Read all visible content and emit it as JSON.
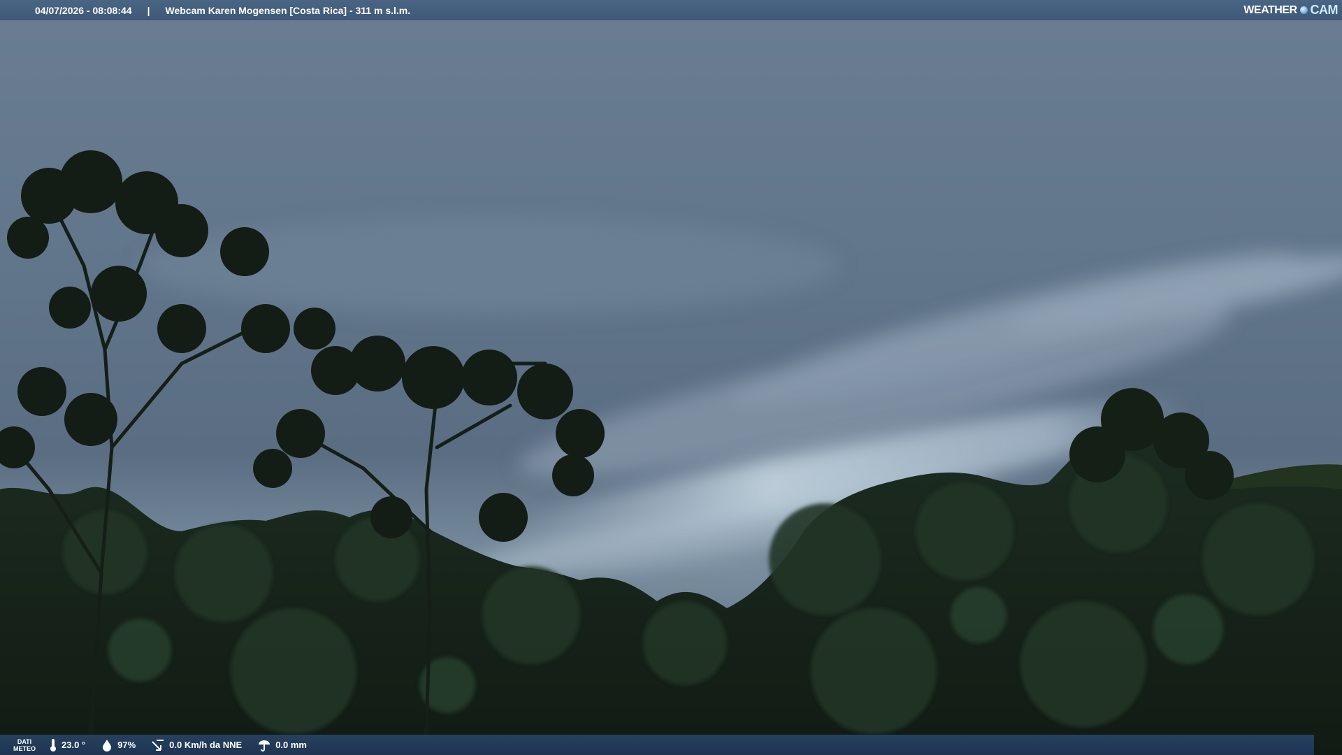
{
  "header": {
    "datetime": "04/07/2026 - 08:08:44",
    "separator": "|",
    "title": "Webcam Karen Mogensen [Costa Rica]  - 311 m s.l.m.",
    "logo_left": "WEATHER",
    "logo_right": "CAM"
  },
  "footer": {
    "label_line1": "DATI",
    "label_line2": "METEO",
    "temperature": "23.0 °",
    "humidity": "97%",
    "wind": "0.0 Km/h da NNE",
    "rain": "0.0 mm",
    "icons": [
      "thermometer-icon",
      "humidity-icon",
      "wind-icon",
      "rain-icon"
    ]
  },
  "colors": {
    "sky_top": "#5f7388",
    "sky_bright": "#b9c9d6",
    "forest": "#17241a",
    "bar_top": "#455f7e",
    "bar_bottom": "#22395a"
  }
}
